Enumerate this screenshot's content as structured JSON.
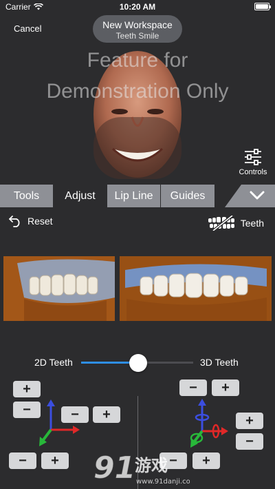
{
  "status_bar": {
    "carrier": "Carrier",
    "time": "10:20 AM"
  },
  "header": {
    "cancel_label": "Cancel",
    "workspace_title": "New Workspace",
    "workspace_subtitle": "Teeth Smile",
    "watermark_line1": "Feature for",
    "watermark_line2": "Demonstration Only",
    "controls_label": "Controls"
  },
  "tabs": [
    {
      "label": "Tools",
      "active": false
    },
    {
      "label": "Adjust",
      "active": true
    },
    {
      "label": "Lip Line",
      "active": false
    },
    {
      "label": "Guides",
      "active": false
    }
  ],
  "toolbar": {
    "reset_label": "Reset",
    "teeth_label": "Teeth"
  },
  "slider": {
    "left_label": "2D Teeth",
    "right_label": "3D Teeth",
    "value": 0.51
  },
  "buttons": {
    "plus": "+",
    "minus": "−"
  },
  "watermark_site": {
    "brand": "游戏",
    "url": "www.91danji.com"
  },
  "colors": {
    "accent": "#2f8fe8",
    "tab_inactive": "#8e9096",
    "button": "#d6d7d9",
    "background": "#2c2c2e"
  }
}
